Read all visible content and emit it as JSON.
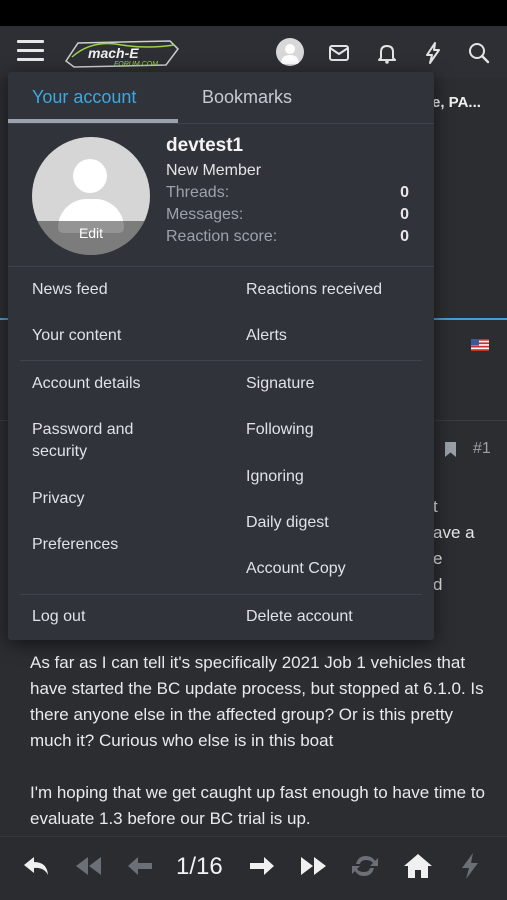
{
  "header": {
    "logo_alt": "mach-e forum.com"
  },
  "background": {
    "thread_title_fragment": "e, PA...",
    "post_number": "#1",
    "fragments": [
      "t",
      "ave a",
      "e",
      "d"
    ],
    "post_paragraphs": [
      "As far as I can tell it's specifically 2021 Job 1 vehicles that have started the BC update process, but stopped at 6.1.0. Is there anyone else in the affected group? Or is this pretty much it? Curious who else is in this boat",
      "I'm hoping that we get caught up fast enough to have time to evaluate 1.3 before our BC trial is up."
    ]
  },
  "menu": {
    "tabs": [
      {
        "label": "Your account",
        "active": true
      },
      {
        "label": "Bookmarks",
        "active": false
      }
    ],
    "profile": {
      "username": "devtest1",
      "user_title": "New Member",
      "avatar_edit_label": "Edit",
      "stats": [
        {
          "label": "Threads:",
          "value": "0"
        },
        {
          "label": "Messages:",
          "value": "0"
        },
        {
          "label": "Reaction score:",
          "value": "0"
        }
      ]
    },
    "links": {
      "news_feed": "News feed",
      "reactions_received": "Reactions received",
      "your_content": "Your content",
      "alerts": "Alerts",
      "account_details": "Account details",
      "signature": "Signature",
      "password_security": "Password and security",
      "following": "Following",
      "ignoring": "Ignoring",
      "privacy": "Privacy",
      "daily_digest": "Daily digest",
      "preferences": "Preferences",
      "account_copy": "Account Copy",
      "log_out": "Log out",
      "delete_account": "Delete account"
    }
  },
  "bottom_bar": {
    "page_indicator": "1/16"
  },
  "colors": {
    "accent": "#3fa6e0",
    "menu_bg": "#30333a",
    "page_bg": "#2b2d31"
  }
}
